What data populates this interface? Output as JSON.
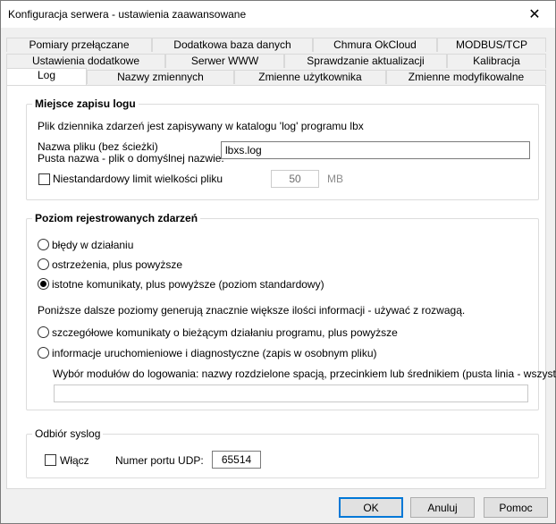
{
  "window": {
    "title": "Konfiguracja serwera - ustawienia zaawansowane",
    "close_glyph": "✕"
  },
  "tabs": {
    "row1": [
      "Pomiary przełączane",
      "Dodatkowa baza danych",
      "Chmura OkCloud",
      "MODBUS/TCP"
    ],
    "row2": [
      "Ustawienia dodatkowe",
      "Serwer WWW",
      "Sprawdzanie aktualizacji",
      "Kalibracja"
    ],
    "row3": [
      "Log",
      "Nazwy zmiennych",
      "Zmienne użytkownika",
      "Zmienne modyfikowalne"
    ],
    "active": "Log"
  },
  "log_location": {
    "legend": "Miejsce zapisu logu",
    "info": "Plik dziennika zdarzeń jest zapisywany w katalogu 'log' programu lbx",
    "filename_label_1": "Nazwa pliku (bez ścieżki)",
    "filename_label_2": "Pusta nazwa - plik o domyślnej nazwie:",
    "filename_value": "lbxs.log",
    "limit_label": "Niestandardowy limit wielkości pliku",
    "limit_checked": false,
    "limit_value": "50",
    "limit_unit": "MB"
  },
  "log_level": {
    "legend": "Poziom rejestrowanych zdarzeń",
    "options": [
      "błędy w działaniu",
      "ostrzeżenia, plus powyższe",
      "istotne komunikaty, plus powyższe (poziom standardowy)"
    ],
    "selected_index": 2,
    "note": "Poniższe dalsze poziomy generują znacznie większe ilości informacji - używać z rozwagą.",
    "extra_options": [
      "szczegółowe komunikaty o bieżącym działaniu programu, plus powyższe",
      "informacje uruchomieniowe i diagnostyczne (zapis w osobnym pliku)"
    ],
    "modules_label": "Wybór modułów do logowania: nazwy rozdzielone spacją, przecinkiem lub średnikiem (pusta linia - wszystko)",
    "modules_value": ""
  },
  "syslog": {
    "legend": "Odbiór syslog",
    "enable_label": "Włącz",
    "enabled": false,
    "port_label": "Numer portu UDP:",
    "port_value": "65514"
  },
  "buttons": {
    "ok": "OK",
    "cancel": "Anuluj",
    "help": "Pomoc"
  }
}
